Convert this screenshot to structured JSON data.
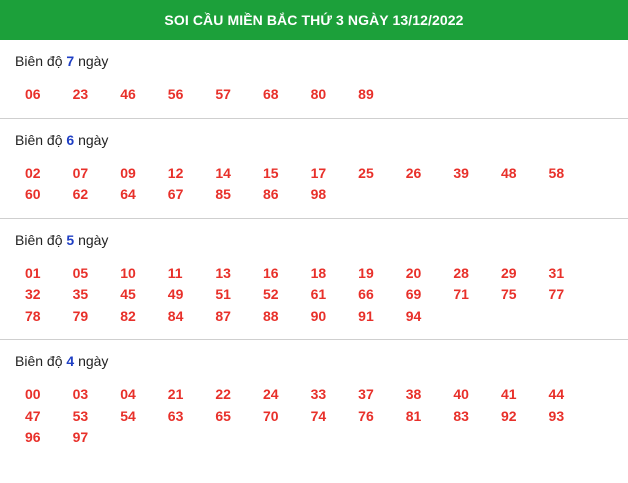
{
  "header": {
    "title": "SOI CẦU MIỀN BẮC THỨ 3 NGÀY 13/12/2022"
  },
  "sections": [
    {
      "label_prefix": "Biên độ",
      "span": "7",
      "label_suffix": "ngày",
      "numbers": [
        "06",
        "23",
        "46",
        "56",
        "57",
        "68",
        "80",
        "89"
      ]
    },
    {
      "label_prefix": "Biên độ",
      "span": "6",
      "label_suffix": "ngày",
      "numbers": [
        "02",
        "07",
        "09",
        "12",
        "14",
        "15",
        "17",
        "25",
        "26",
        "39",
        "48",
        "58",
        "60",
        "62",
        "64",
        "67",
        "85",
        "86",
        "98"
      ]
    },
    {
      "label_prefix": "Biên độ",
      "span": "5",
      "label_suffix": "ngày",
      "numbers": [
        "01",
        "05",
        "10",
        "11",
        "13",
        "16",
        "18",
        "19",
        "20",
        "28",
        "29",
        "31",
        "32",
        "35",
        "45",
        "49",
        "51",
        "52",
        "61",
        "66",
        "69",
        "71",
        "75",
        "77",
        "78",
        "79",
        "82",
        "84",
        "87",
        "88",
        "90",
        "91",
        "94"
      ]
    },
    {
      "label_prefix": "Biên độ",
      "span": "4",
      "label_suffix": "ngày",
      "numbers": [
        "00",
        "03",
        "04",
        "21",
        "22",
        "24",
        "33",
        "37",
        "38",
        "40",
        "41",
        "44",
        "47",
        "53",
        "54",
        "63",
        "65",
        "70",
        "74",
        "76",
        "81",
        "83",
        "92",
        "93",
        "96",
        "97"
      ]
    }
  ],
  "colors": {
    "header_bg": "#1ca03a",
    "number": "#e8302a",
    "span": "#1f3fc4"
  }
}
